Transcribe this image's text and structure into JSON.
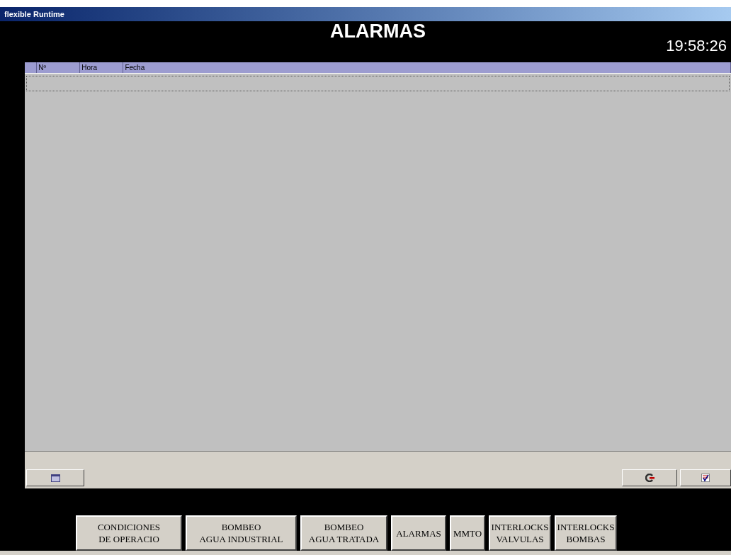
{
  "window": {
    "title": "flexible Runtime"
  },
  "header": {
    "title": "ALARMAS",
    "time": "19:58:26"
  },
  "table": {
    "columns": [
      "Nº",
      "Hora",
      "Fecha"
    ]
  },
  "nav_buttons": [
    {
      "label": "CONDICIONES\nDE OPERACIO"
    },
    {
      "label": "BOMBEO\nAGUA INDUSTRIAL"
    },
    {
      "label": "BOMBEO\nAGUA TRATADA"
    },
    {
      "label": "ALARMAS"
    },
    {
      "label": "MMTO"
    },
    {
      "label": "INTERLOCKS\nVALVULAS"
    },
    {
      "label": "INTERLOCKS\nBOMBAS"
    }
  ]
}
